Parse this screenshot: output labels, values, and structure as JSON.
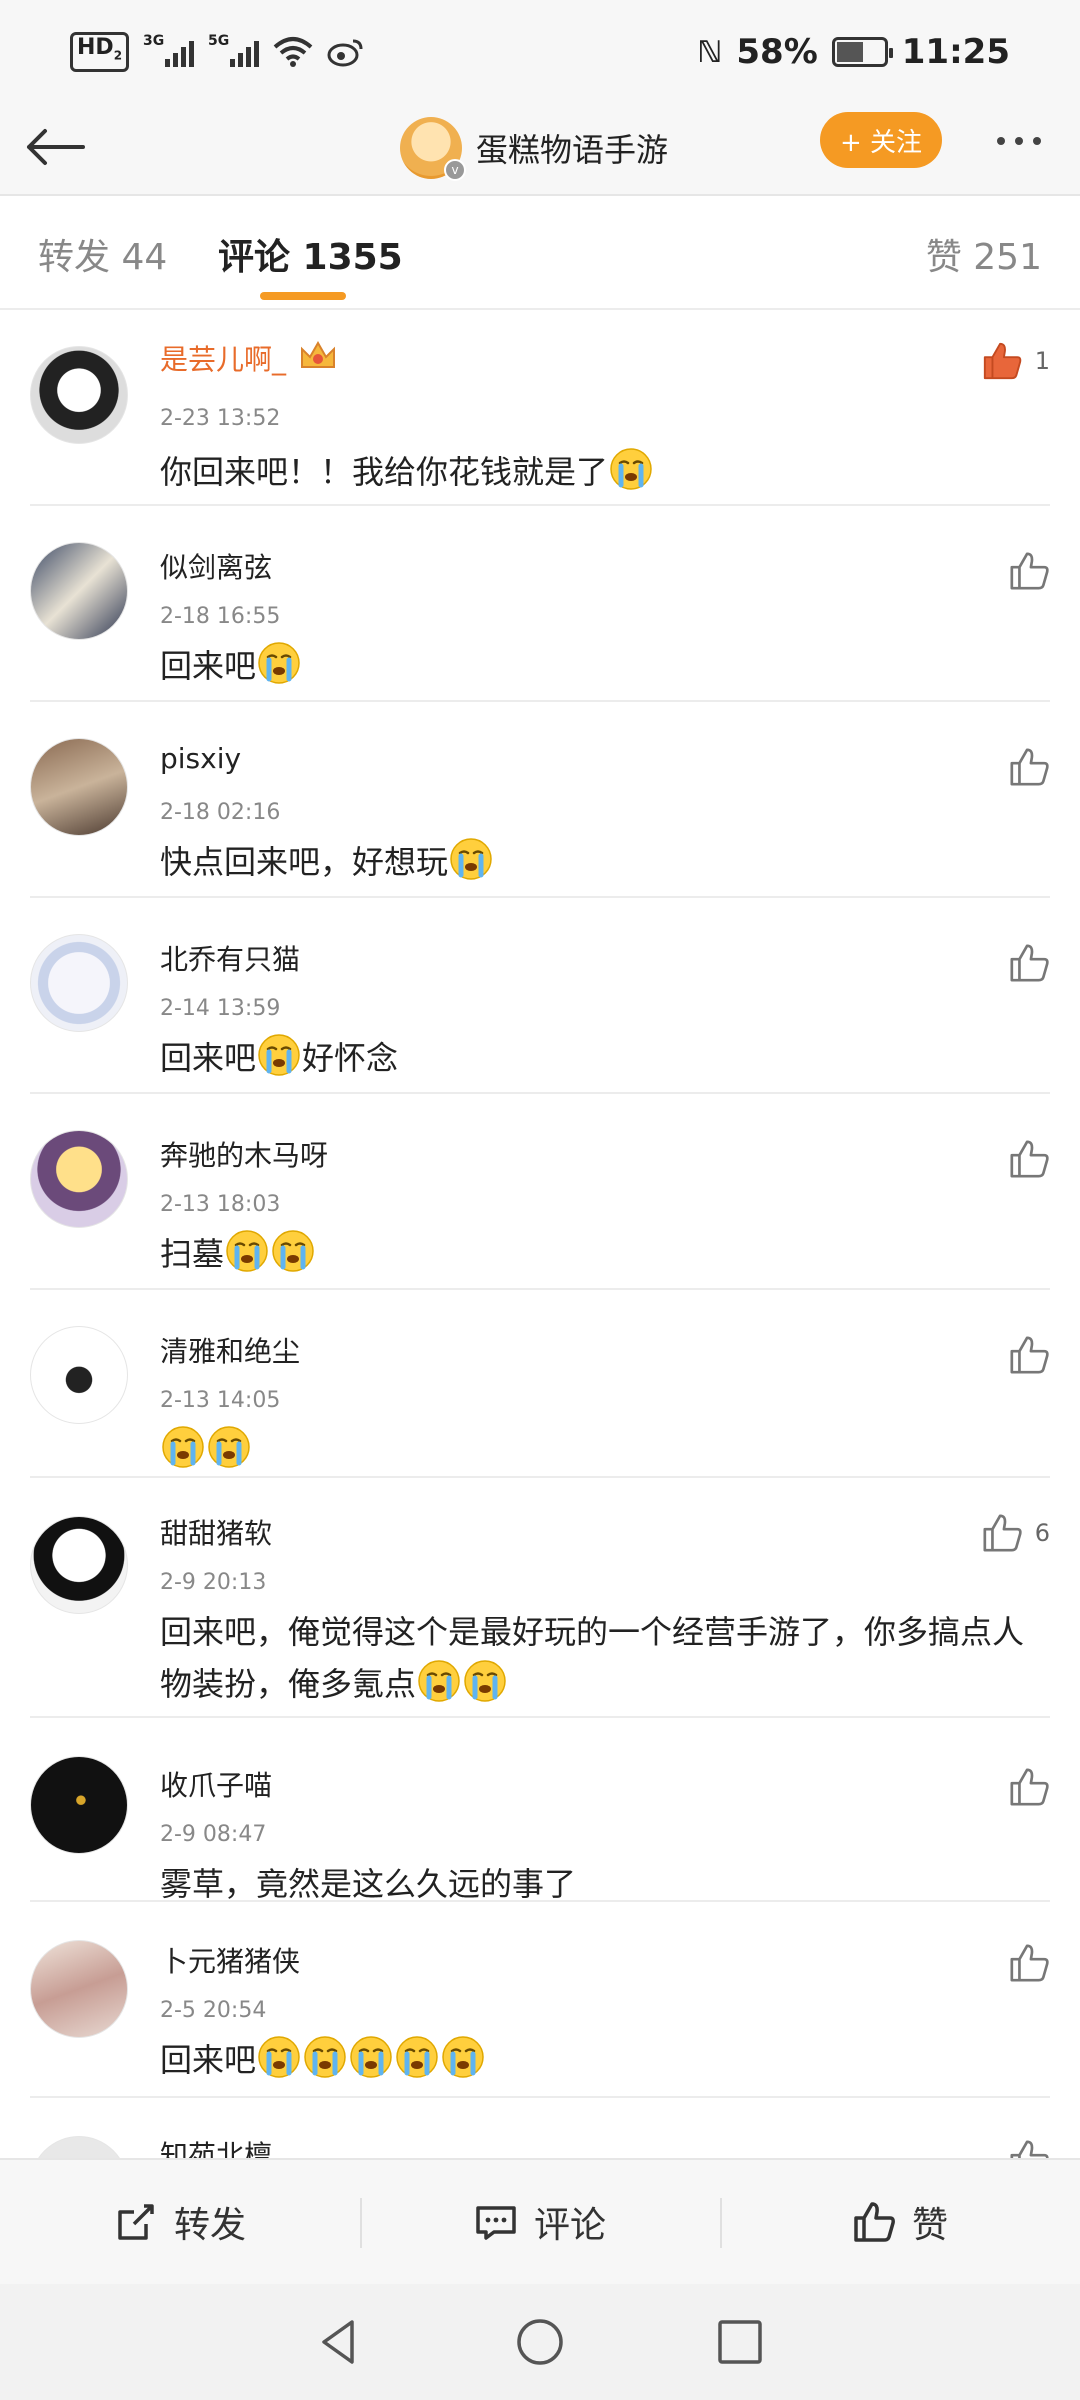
{
  "status_bar": {
    "hd_badge": "HD",
    "hd_sub": "2",
    "sig1_label": "3G",
    "sig2_label": "5G",
    "battery_percent": "58%",
    "battery_level": 0.58,
    "time": "11:25"
  },
  "header": {
    "title": "蛋糕物语手游",
    "follow_label": "+ 关注"
  },
  "tabs": [
    {
      "label": "转发 44"
    },
    {
      "label": "评论 1355"
    },
    {
      "label": "赞 251"
    }
  ],
  "comments": [
    {
      "name": "是芸儿啊_",
      "time": "2-23 13:52",
      "text": "你回来吧！！我给你花钱就是了",
      "emojis": 1,
      "likes": "1"
    },
    {
      "name": "似剑离弦",
      "time": "2-18 16:55",
      "text": "回来吧",
      "emojis": 1,
      "likes": ""
    },
    {
      "name": "pisxiy",
      "time": "2-18 02:16",
      "text": "快点回来吧，好想玩",
      "emojis": 1,
      "likes": ""
    },
    {
      "name": "北乔有只猫",
      "time": "2-14 13:59",
      "text": "回来吧",
      "text_after": "好怀念",
      "emojis": 1,
      "likes": ""
    },
    {
      "name": "奔驰的木马呀",
      "time": "2-13 18:03",
      "text": "扫墓",
      "emojis": 2,
      "likes": ""
    },
    {
      "name": "清雅和绝尘",
      "time": "2-13 14:05",
      "text": "",
      "emojis": 2,
      "likes": ""
    },
    {
      "name": "甜甜猪软",
      "time": "2-9 20:13",
      "text": "回来吧，俺觉得这个是最好玩的一个经营手游了，你多搞点人物装扮，俺多氪点",
      "emojis": 2,
      "likes": "6"
    },
    {
      "name": "收爪子喵",
      "time": "2-9 08:47",
      "text": "雾草，竟然是这么久远的事了",
      "emojis": 0,
      "likes": ""
    },
    {
      "name": "卜元猪猪侠",
      "time": "2-5 20:54",
      "text": "回来吧",
      "emojis": 5,
      "likes": ""
    },
    {
      "name": "知苑北檀",
      "time": "",
      "text": "",
      "emojis": 0,
      "likes": ""
    }
  ],
  "bottom_bar": {
    "repost_label": "转发",
    "comment_label": "评论",
    "like_label": "赞"
  },
  "colors": {
    "accent": "#f59a23",
    "vip_name": "#e86b2a",
    "liked_thumb": "#e8663a"
  }
}
